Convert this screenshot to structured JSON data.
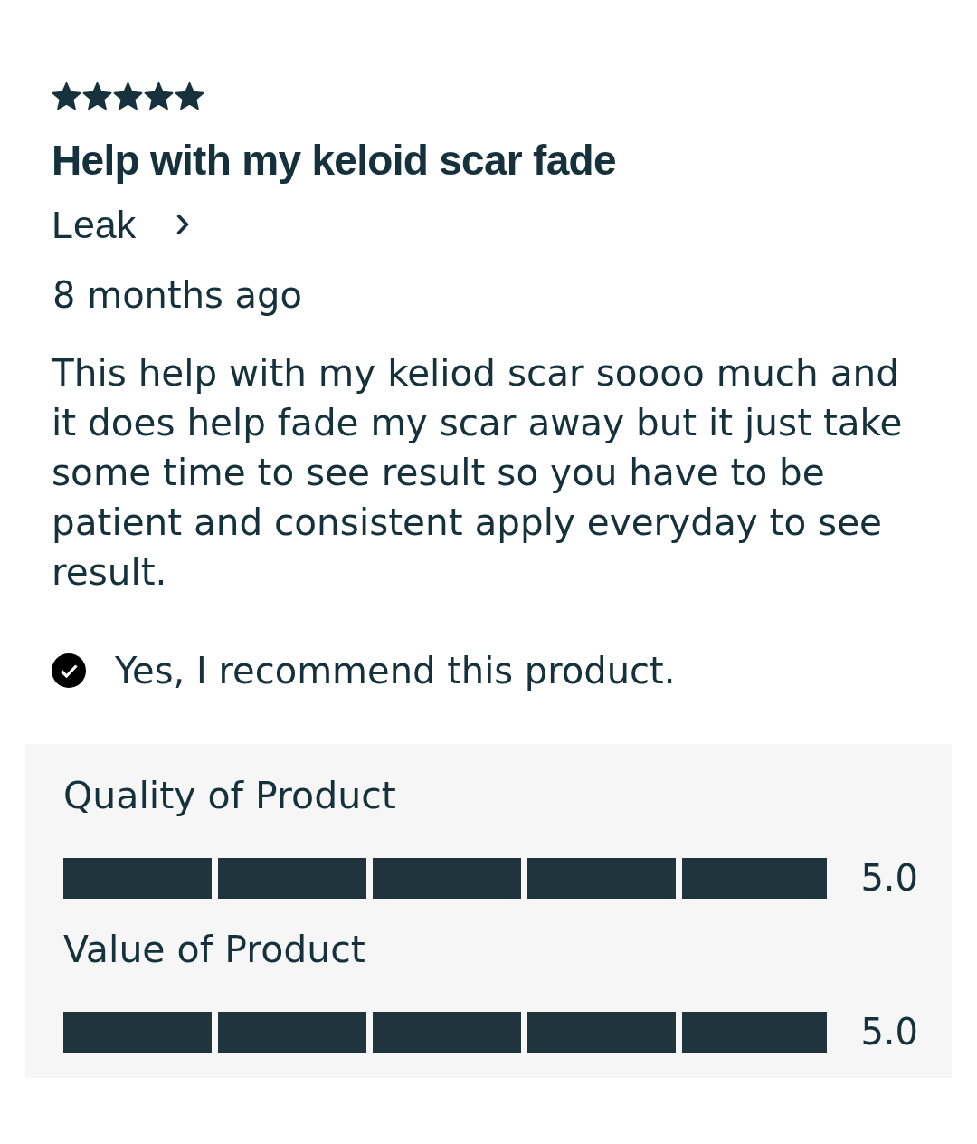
{
  "review": {
    "stars": 5,
    "title": "Help with my keloid scar fade",
    "author": "Leak",
    "date": "8 months ago",
    "body": "This help with my keliod scar soooo much and it does help fade my scar away but it just take some time to see result so you have to be patient and consistent apply everyday to see result.",
    "recommend": {
      "checked": true,
      "text": "Yes, I recommend this product."
    }
  },
  "ratings": [
    {
      "label": "Quality of Product",
      "level": 1,
      "reading": "5.0"
    },
    {
      "label": "Value of Product",
      "level": 1,
      "reading": "5.0"
    }
  ]
}
